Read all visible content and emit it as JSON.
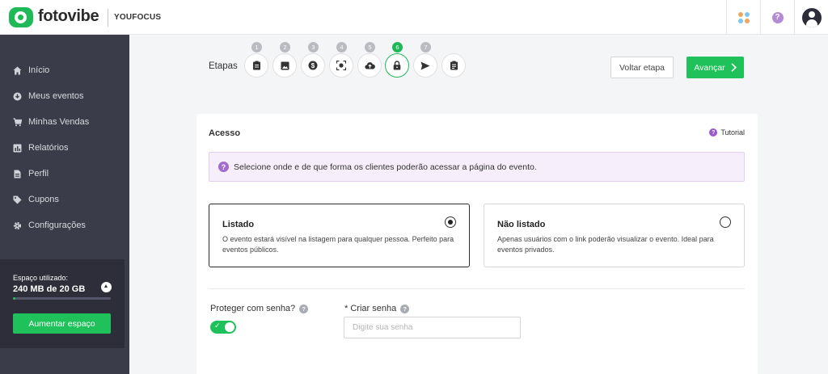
{
  "brand": {
    "name": "fotovibe",
    "partner": "YOUFOCUS",
    "accent": "#1fc15a"
  },
  "topbar": {
    "apps_icon": "apps-grid-icon",
    "apps_dot_colors": [
      "#f1a45a",
      "#7fc7ec",
      "#7fc7ec",
      "#f1a45a"
    ],
    "help_icon": "help-circle-icon",
    "help_glyph": "?",
    "user_icon": "user-avatar-icon"
  },
  "sidebar": {
    "items": [
      {
        "label": "Início",
        "icon": "home-icon"
      },
      {
        "label": "Meus eventos",
        "icon": "download-circle-icon"
      },
      {
        "label": "Minhas Vendas",
        "icon": "cart-icon"
      },
      {
        "label": "Relatórios",
        "icon": "chart-icon"
      },
      {
        "label": "Perfil",
        "icon": "profile-document-icon"
      },
      {
        "label": "Cupons",
        "icon": "tag-icon"
      },
      {
        "label": "Configurações",
        "icon": "gear-icon"
      }
    ],
    "storage": {
      "label": "Espaço utilizado:",
      "value": "240 MB de 20 GB",
      "used_fraction": 0.012,
      "button": "Aumentar espaço"
    }
  },
  "steps": {
    "label": "Etapas",
    "active": 6,
    "items": [
      {
        "number": "1",
        "icon": "clipboard-icon"
      },
      {
        "number": "2",
        "icon": "image-icon"
      },
      {
        "number": "3",
        "icon": "dollar-icon"
      },
      {
        "number": "4",
        "icon": "face-scan-icon"
      },
      {
        "number": "5",
        "icon": "cloud-upload-icon"
      },
      {
        "number": "6",
        "icon": "lock-icon"
      },
      {
        "number": "7",
        "icon": "send-icon"
      },
      {
        "number": "",
        "icon": "checklist-icon"
      }
    ]
  },
  "actions": {
    "back": "Voltar etapa",
    "next": "Avançar",
    "next_icon": "chevron-right-icon"
  },
  "section": {
    "title": "Acesso",
    "tutorial": "Tutorial",
    "info": "Selecione onde e de que forma os clientes poderão acessar a página do evento.",
    "options": [
      {
        "title": "Listado",
        "description": "O evento estará visível na listagem para qualquer pessoa. Perfeito para eventos públicos.",
        "selected": true
      },
      {
        "title": "Não listado",
        "description": "Apenas usuários com o link poderão visualizar o evento. Ideal para eventos privados.",
        "selected": false
      }
    ],
    "protect_label": "Proteger com senha?",
    "protect_enabled": true,
    "password_label": "* Criar senha",
    "password_placeholder": "Digite sua senha",
    "password_value": ""
  }
}
